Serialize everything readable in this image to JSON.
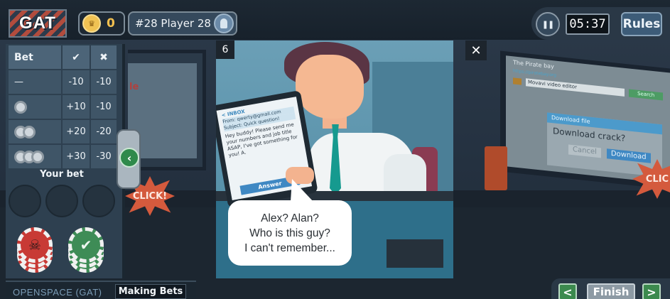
{
  "header": {
    "logo_text": "GAT",
    "coins": "0",
    "player_name": "#28 Player 28",
    "timer": "05:37",
    "rules_label": "Rules"
  },
  "bet_panel": {
    "headers": {
      "bet": "Bet",
      "correct_icon": "checkmark-icon",
      "wrong_icon": "cross-icon"
    },
    "rows": [
      {
        "bet": "—",
        "correct": "-10",
        "wrong": "-10",
        "chips": 0
      },
      {
        "bet": "1 chip",
        "correct": "+10",
        "wrong": "-10",
        "chips": 1
      },
      {
        "bet": "2 chips",
        "correct": "+20",
        "wrong": "-20",
        "chips": 2
      },
      {
        "bet": "3 chips",
        "correct": "+30",
        "wrong": "-30",
        "chips": 3
      }
    ],
    "your_bet_label": "Your bet",
    "stacks": [
      "red-bad-chip-stack",
      "green-good-chip-stack"
    ]
  },
  "modal": {
    "counter": "6",
    "close_label": "✕",
    "tablet": {
      "inbox": "< INBOX",
      "from": "From: qwerty@gmail.com",
      "subject": "Subject: Quick question!",
      "body": "Hey buddy! Please send me your numbers and job title ASAP, I've got something for you! A.",
      "answer": "Answer"
    },
    "speech_lines": [
      "Alex? Alan?",
      "Who is this guy?",
      "I can't remember..."
    ]
  },
  "background": {
    "left_screen_text": "le",
    "click_left": "CLICK!",
    "click_right": "CLIC",
    "right_screen": {
      "title": "The Pirate bay",
      "url": "https://piratebay.org",
      "search_value": "Movavi video editor",
      "search_button": "Search",
      "dialog_title": "Download file",
      "dialog_text": "Download crack?",
      "cancel": "Cancel",
      "download": "Download"
    }
  },
  "footer": {
    "section_label": "OPENSPACE (GAT)",
    "phase_label": "Making Bets",
    "prev_label": "<",
    "finish_label": "Finish",
    "next_label": ">"
  },
  "colors": {
    "coin": "#f0c253",
    "accent_green": "#3c8a4e",
    "accent_red": "#c83a35",
    "panel": "#2e4050"
  }
}
